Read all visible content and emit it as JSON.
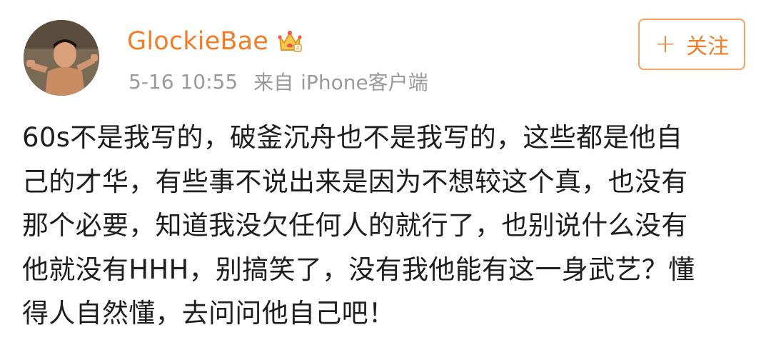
{
  "post": {
    "author": {
      "username": "GlockieBae",
      "avatar_icon": "avatar-image",
      "badge_icon": "crown-vip-icon"
    },
    "meta": {
      "time": "5-16 10:55",
      "source_prefix": "来自",
      "source": "iPhone客户端"
    },
    "follow_button": {
      "icon": "+",
      "label": "关注"
    },
    "content_lines": [
      "60s不是我写的，破釜沉舟也不是我写的，这些都是他自",
      "己的才华，有些事不说出来是因为不想较这个真，也没有",
      "那个必要，知道我没欠任何人的就行了，也别说什么没有",
      "他就没有HHH，别搞笑了，没有我他能有这一身武艺？懂",
      "得人自然懂，去问问他自己吧！"
    ]
  },
  "colors": {
    "username": "#f17d28",
    "follow_border": "#f5a15f",
    "meta_text": "#9a9a9a",
    "body_text": "#1e1e1e"
  }
}
